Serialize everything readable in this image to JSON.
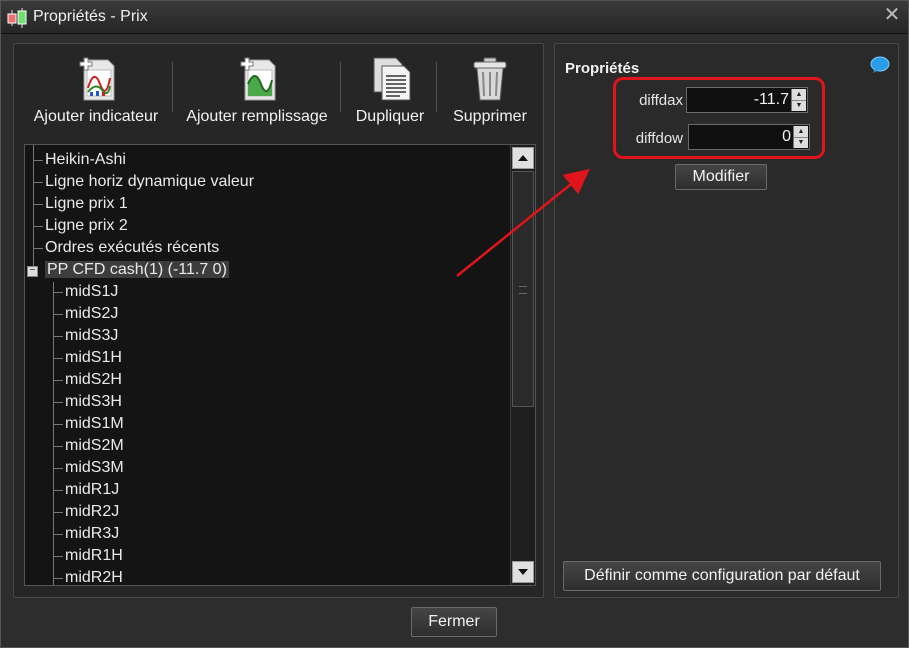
{
  "window": {
    "title": "Propriétés - Prix"
  },
  "toolbar": {
    "add_indicator": "Ajouter indicateur",
    "add_fill": "Ajouter remplissage",
    "duplicate": "Dupliquer",
    "delete": "Supprimer"
  },
  "tree": {
    "root_items": [
      "Heikin-Ashi",
      "Ligne horiz dynamique valeur",
      "Ligne prix 1",
      "Ligne prix 2",
      "Ordres exécutés récents"
    ],
    "selected": "PP CFD cash(1) (-11.7 0)",
    "children": [
      "midS1J",
      "midS2J",
      "midS3J",
      "midS1H",
      "midS2H",
      "midS3H",
      "midS1M",
      "midS2M",
      "midS3M",
      "midR1J",
      "midR2J",
      "midR3J",
      "midR1H",
      "midR2H"
    ]
  },
  "properties": {
    "title": "Propriétés",
    "fields": [
      {
        "label": "diffdax",
        "value": "-11.7"
      },
      {
        "label": "diffdow",
        "value": "0"
      }
    ],
    "modify_label": "Modifier",
    "set_default_label": "Définir comme configuration par défaut"
  },
  "footer": {
    "close_label": "Fermer"
  },
  "colors": {
    "highlight": "#e0141b",
    "background": "#2d2d2d"
  }
}
